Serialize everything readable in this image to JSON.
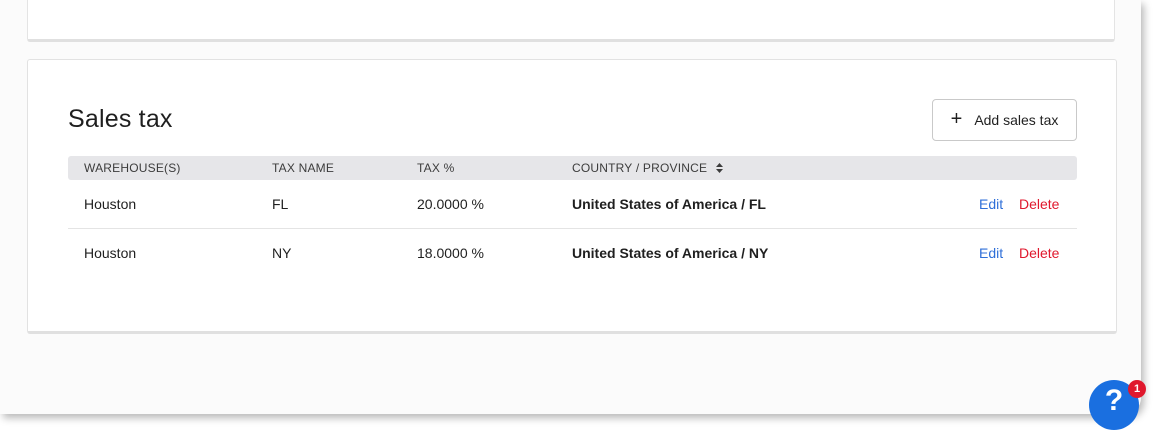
{
  "section": {
    "title": "Sales tax",
    "add_button_label": "Add sales tax"
  },
  "table": {
    "columns": [
      "WAREHOUSE(S)",
      "TAX NAME",
      "TAX %",
      "COUNTRY / PROVINCE"
    ],
    "rows": [
      {
        "warehouse": "Houston",
        "tax_name": "FL",
        "tax_percent": "20.0000 %",
        "country_province": "United States of America / FL",
        "edit_label": "Edit",
        "delete_label": "Delete"
      },
      {
        "warehouse": "Houston",
        "tax_name": "NY",
        "tax_percent": "18.0000 %",
        "country_province": "United States of America / NY",
        "edit_label": "Edit",
        "delete_label": "Delete"
      }
    ]
  },
  "help": {
    "icon_label": "?",
    "badge_count": "1"
  },
  "icons": {
    "add": "plus-icon",
    "sort": "sort-icon",
    "help": "question-icon"
  },
  "colors": {
    "edit_link": "#2f6fd8",
    "delete_link": "#e0182d",
    "help_button": "#1a6fe0",
    "header_bg": "#e6e6e9"
  }
}
